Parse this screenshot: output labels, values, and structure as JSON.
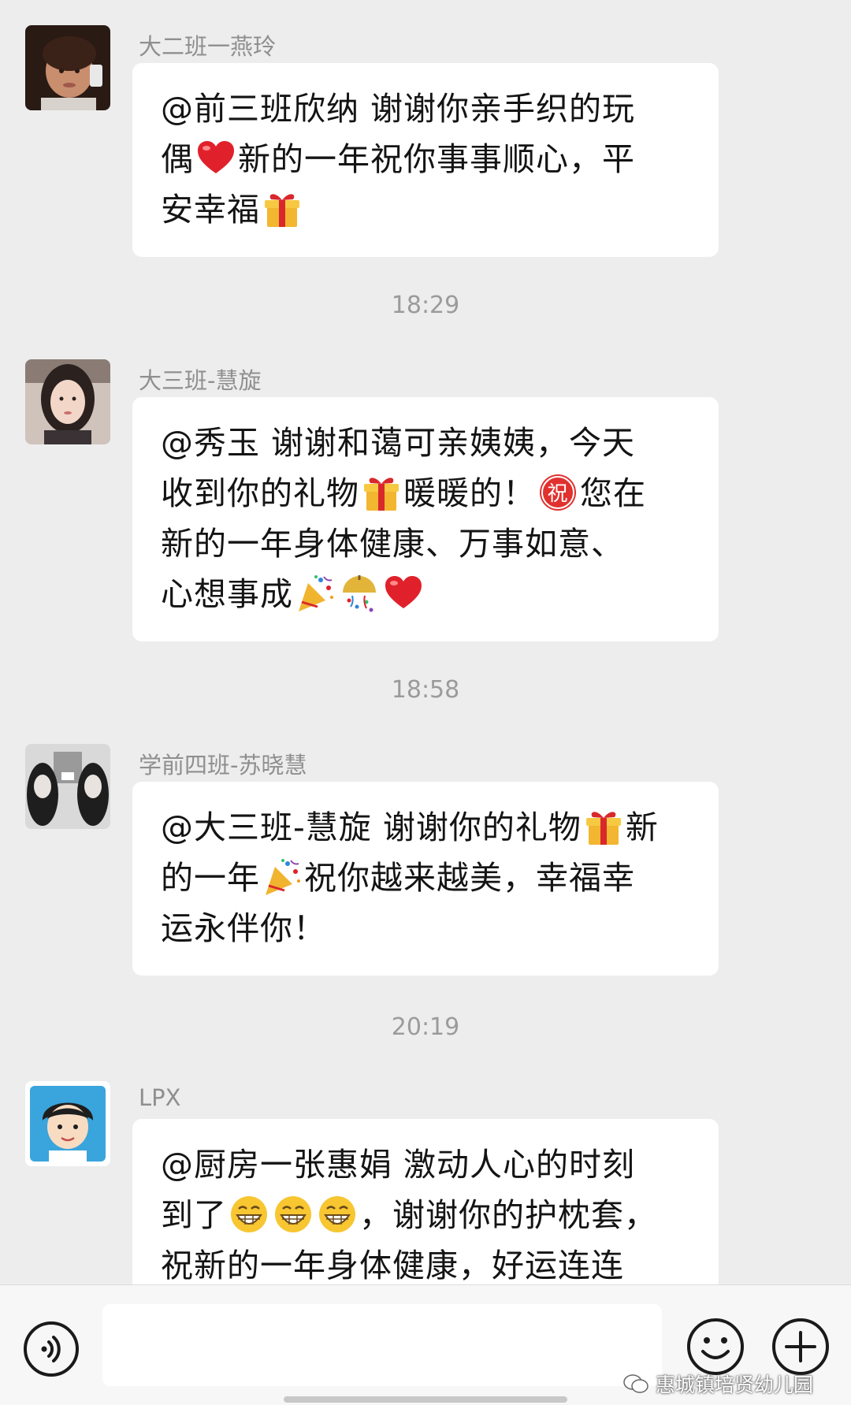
{
  "messages": [
    {
      "sender": "大二班一燕玲",
      "lines": [
        {
          "a": "@前三班欣纳 谢谢你亲手织的玩"
        },
        {
          "a": "偶",
          "e1": "red-heart-emoji",
          "b": "新的一年祝你事事顺心，平"
        },
        {
          "a": "安幸福",
          "e1": "gift-emoji"
        }
      ]
    },
    {
      "sender": "大三班-慧旋",
      "lines": [
        {
          "a": "@秀玉 谢谢和蔼可亲姨姨，今天"
        },
        {
          "a": "收到你的礼物",
          "e1": "gift-emoji",
          "b": "暖暖的！",
          "e2": "blessing-emoji",
          "c": "您在"
        },
        {
          "a": "新的一年身体健康、万事如意、"
        },
        {
          "a": "心想事成",
          "e1": "party-popper-emoji",
          "e2": "confetti-ball-emoji",
          "e3": "red-heart-emoji"
        }
      ]
    },
    {
      "sender": "学前四班-苏晓慧",
      "lines": [
        {
          "a": "@大三班-慧旋  谢谢你的礼物",
          "e1": "gift-emoji",
          "b": "新"
        },
        {
          "a": "的一年",
          "e1": "party-popper-emoji",
          "b": "祝你越来越美，幸福幸"
        },
        {
          "a": "运永伴你！"
        }
      ]
    },
    {
      "sender": "LPX",
      "lines": [
        {
          "a": "@厨房一张惠娟  激动人心的时刻"
        },
        {
          "a": "到了",
          "e1": "grin-emoji",
          "e2": "grin-emoji",
          "e3": "grin-emoji",
          "b": "，谢谢你的护枕套，"
        },
        {
          "a": "祝新的一年身体健康，好运连连"
        }
      ]
    }
  ],
  "timestamps": [
    "18:29",
    "18:58",
    "20:19"
  ],
  "watermark": "惠城镇培贤幼儿园",
  "icons": {
    "voice": "voice-icon",
    "emoji": "smiley-icon",
    "more": "plus-icon"
  }
}
